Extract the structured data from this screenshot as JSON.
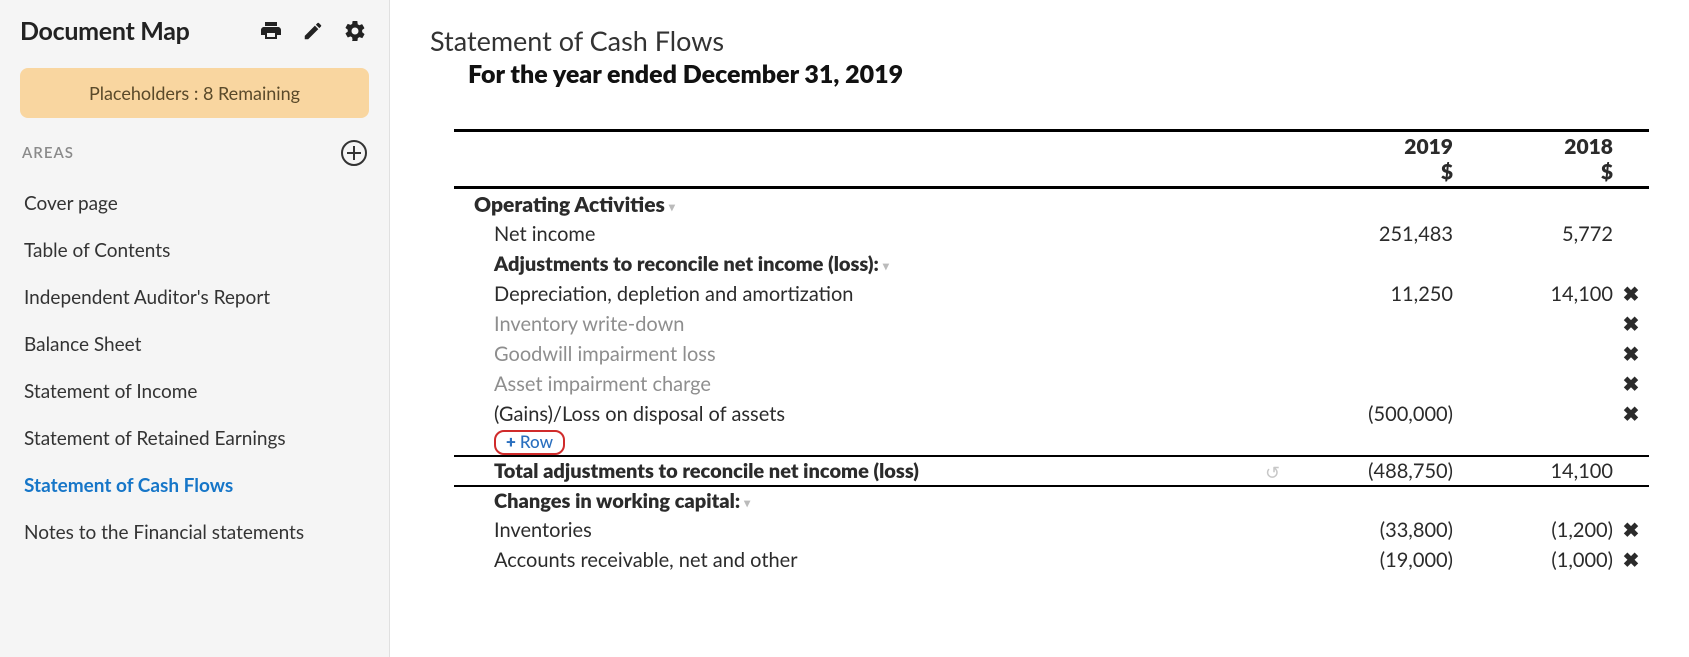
{
  "sidebar": {
    "title": "Document Map",
    "placeholders_label": "Placeholders : 8 Remaining",
    "areas_label": "AREAS",
    "items": [
      {
        "label": "Cover page"
      },
      {
        "label": "Table of Contents"
      },
      {
        "label": "Independent Auditor's Report"
      },
      {
        "label": "Balance Sheet"
      },
      {
        "label": "Statement of Income"
      },
      {
        "label": "Statement of Retained Earnings"
      },
      {
        "label": "Statement of Cash Flows"
      },
      {
        "label": "Notes to the Financial statements"
      }
    ],
    "active_index": 6
  },
  "document": {
    "title": "Statement of Cash Flows",
    "subtitle": "For the year ended December 31, 2019",
    "year1": "2019",
    "year2": "2018",
    "currency": "$",
    "sections": {
      "operating_activities": {
        "heading": "Operating Activities",
        "net_income": {
          "label": "Net income",
          "v1": "251,483",
          "v2": "5,772"
        },
        "adjustments_heading": "Adjustments to reconcile net income (loss):",
        "adjustments": [
          {
            "label": "Depreciation, depletion and amortization",
            "v1": "11,250",
            "v2": "14,100",
            "removable": true,
            "muted": false
          },
          {
            "label": "Inventory write-down",
            "v1": "",
            "v2": "",
            "removable": true,
            "muted": true
          },
          {
            "label": "Goodwill impairment loss",
            "v1": "",
            "v2": "",
            "removable": true,
            "muted": true
          },
          {
            "label": "Asset impairment charge",
            "v1": "",
            "v2": "",
            "removable": true,
            "muted": true
          },
          {
            "label": "(Gains)/Loss on disposal of assets",
            "v1": "(500,000)",
            "v2": "",
            "removable": true,
            "muted": false
          }
        ],
        "add_row_label": "Row",
        "total_adjustments": {
          "label": "Total adjustments to reconcile net income (loss)",
          "v1": "(488,750)",
          "v2": "14,100"
        },
        "working_capital_heading": "Changes in working capital:",
        "working_capital": [
          {
            "label": "Inventories",
            "v1": "(33,800)",
            "v2": "(1,200)",
            "removable": true
          },
          {
            "label": "Accounts receivable, net and other",
            "v1": "(19,000)",
            "v2": "(1,000)",
            "removable": true
          }
        ]
      }
    }
  }
}
